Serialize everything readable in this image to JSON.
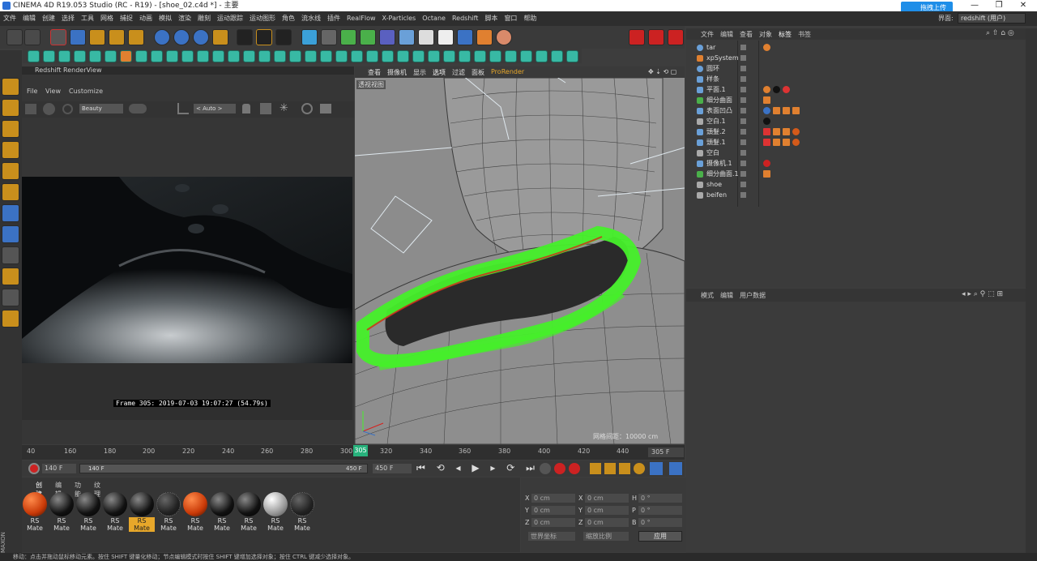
{
  "window": {
    "title": "CINEMA 4D R19.053 Studio (RC - R19) - [shoe_02.c4d *] - 主要",
    "upload_button": "拖拽上传",
    "layout_label": "界面:",
    "layout_value": "redshift (用户)"
  },
  "menubar": [
    "文件",
    "编辑",
    "创建",
    "选择",
    "工具",
    "网格",
    "捕捉",
    "动画",
    "模拟",
    "渲染",
    "雕刻",
    "运动跟踪",
    "运动图形",
    "角色",
    "流水线",
    "插件",
    "RealFlow",
    "X-Particles",
    "Octane",
    "Redshift",
    "脚本",
    "窗口",
    "帮助"
  ],
  "renderview": {
    "title": "Redshift RenderView",
    "menu": [
      "File",
      "View",
      "Customize"
    ],
    "aov": "Beauty",
    "zoom": "< Auto >",
    "frame_label": "Frame  305:  2019-07-03  19:07:27  (54.79s)"
  },
  "viewport": {
    "menu": [
      "查看",
      "摄像机",
      "显示",
      "选项",
      "过滤",
      "面板",
      "ProRender"
    ],
    "view_name": "透视视图",
    "grid_spacing": "网格间距：10000 cm"
  },
  "object_manager": {
    "tabs": [
      "文件",
      "编辑",
      "查看",
      "对象",
      "标签",
      "书签"
    ],
    "objects": [
      {
        "name": "tar",
        "color": "#6aa0d8"
      },
      {
        "name": "xpSystem",
        "color": "#e08030"
      },
      {
        "name": "圆环",
        "color": "#6aa0d8"
      },
      {
        "name": "样条",
        "color": "#6aa0d8"
      },
      {
        "name": "平面.1",
        "color": "#6aa0d8"
      },
      {
        "name": "细分曲面",
        "color": "#4ab04a"
      },
      {
        "name": "表面凹凸",
        "color": "#6aa0d8"
      },
      {
        "name": "空白.1",
        "color": "#aaaaaa"
      },
      {
        "name": "頭髮.2",
        "color": "#6aa0d8"
      },
      {
        "name": "頭髮.1",
        "color": "#6aa0d8"
      },
      {
        "name": "空白",
        "color": "#aaaaaa"
      },
      {
        "name": "摄像机.1",
        "color": "#6aa0d8"
      },
      {
        "name": "细分曲面.1",
        "color": "#4ab04a"
      },
      {
        "name": "shoe",
        "color": "#aaaaaa"
      },
      {
        "name": "beifen",
        "color": "#aaaaaa"
      }
    ]
  },
  "attribute_manager": {
    "tabs": [
      "模式",
      "编辑",
      "用户数据"
    ]
  },
  "timeline": {
    "ticks": [
      "40",
      "160",
      "180",
      "200",
      "220",
      "240",
      "260",
      "280",
      "300",
      "320",
      "340",
      "360",
      "380",
      "400",
      "420",
      "440"
    ],
    "current": "305",
    "end_field": "305 F"
  },
  "controls": {
    "start_field": "140 F",
    "range_start": "140 F",
    "range_end": "450 F",
    "end_field": "450 F"
  },
  "material_manager": {
    "tabs": [
      "创建",
      "编辑",
      "功能",
      "纹理"
    ],
    "materials": [
      {
        "label": "RS Mate",
        "kind": "orange"
      },
      {
        "label": "RS Mate",
        "kind": "black"
      },
      {
        "label": "RS Mate",
        "kind": "black"
      },
      {
        "label": "RS Mate",
        "kind": "black"
      },
      {
        "label": "RS Mate",
        "kind": "black-selected"
      },
      {
        "label": "RS Mate",
        "kind": "mesh"
      },
      {
        "label": "RS Mate",
        "kind": "orange"
      },
      {
        "label": "RS Mate",
        "kind": "black"
      },
      {
        "label": "RS Mate",
        "kind": "black"
      },
      {
        "label": "RS Mate",
        "kind": "grey"
      },
      {
        "label": "RS Mate",
        "kind": "mesh"
      }
    ]
  },
  "coordinates": {
    "x_pos": "0 cm",
    "y_pos": "0 cm",
    "z_pos": "0 cm",
    "x_size": "0 cm",
    "y_size": "0 cm",
    "z_size": "0 cm",
    "h": "0 °",
    "p": "0 °",
    "b": "0 °",
    "space": "世界坐标",
    "scale": "缩放比例",
    "apply": "应用"
  },
  "status": "移动：点击并拖动鼠标移动元素。按住 SHIFT 键量化移动；节点编辑模式时按住 SHIFT 键增加选择对象；按住 CTRL 键减少选择对象。"
}
